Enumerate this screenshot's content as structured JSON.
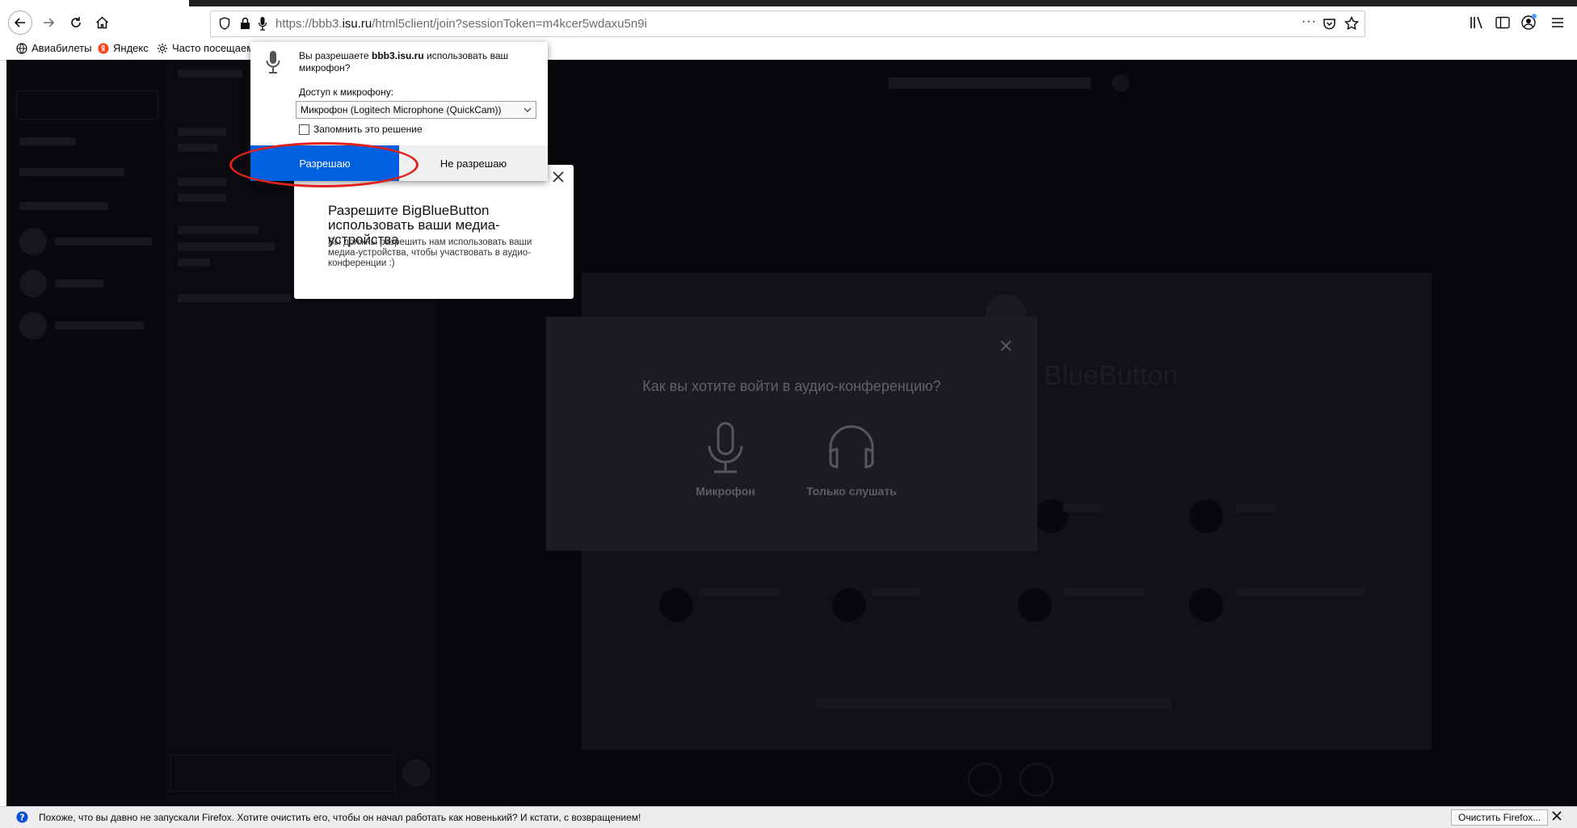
{
  "browser": {
    "url_prefix": "https://bbb3.",
    "url_host": "isu.ru",
    "url_path": "/html5client/join?sessionToken=m4kcer5wdaxu5n9i",
    "page_actions_label": "···",
    "bookmarks": [
      {
        "label": "Авиабилеты",
        "icon": "globe-icon"
      },
      {
        "label": "Яндекс",
        "icon": "yandex-icon"
      },
      {
        "label": "Часто посещаемые",
        "icon": "gear-icon"
      }
    ]
  },
  "permission": {
    "question_prefix": "Вы разрешаете ",
    "question_host": "bbb3.isu.ru",
    "question_suffix": " использовать ваш микрофон?",
    "access_label": "Доступ к микрофону:",
    "selected_device": "Микрофон (Logitech Microphone (QuickCam))",
    "remember_label": "Запомнить это решение",
    "allow_label": "Разрешаю",
    "deny_label": "Не разрешаю",
    "colors": {
      "allow": "#0060df",
      "highlight": "#e0201b"
    }
  },
  "tooltip": {
    "title": "Разрешите BigBlueButton использовать ваши медиа-устройства",
    "text": "Вы должны разрешить нам использовать ваши медиа-устройства, чтобы участвовать в аудио-конференции :)"
  },
  "audio_modal": {
    "title": "Как вы хотите войти в аудио-конференцию?",
    "mic_label": "Микрофон",
    "listen_label": "Только слушать"
  },
  "background": {
    "presentation_title": "BlueButton"
  },
  "notification": {
    "text": "Похоже, что вы давно не запускали Firefox. Хотите очистить его, чтобы он начал работать как новенький? И кстати, с возвращением!",
    "button_label": "Очистить Firefox..."
  }
}
